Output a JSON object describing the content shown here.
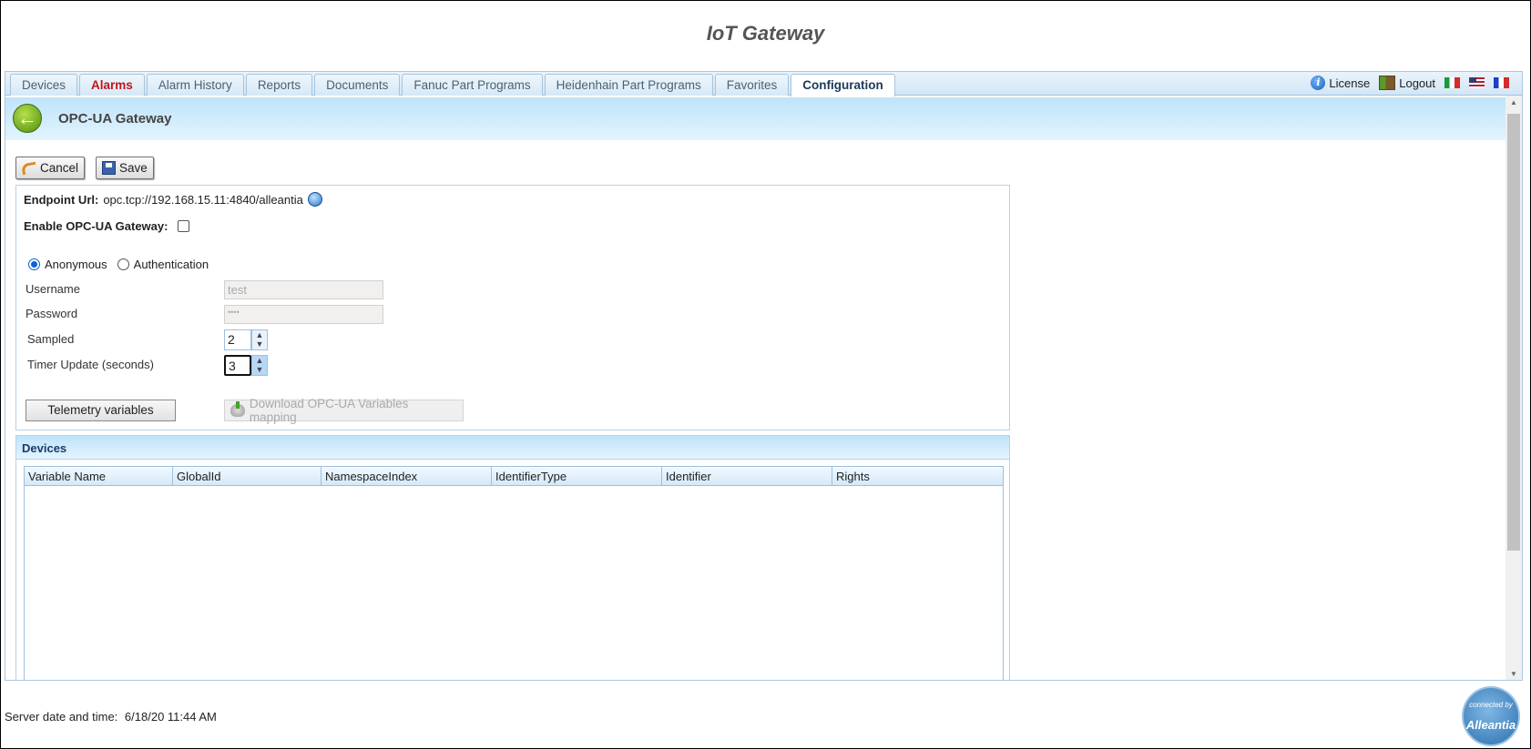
{
  "app": {
    "title": "IoT Gateway"
  },
  "tabs": [
    {
      "label": "Devices"
    },
    {
      "label": "Alarms"
    },
    {
      "label": "Alarm History"
    },
    {
      "label": "Reports"
    },
    {
      "label": "Documents"
    },
    {
      "label": "Fanuc Part Programs"
    },
    {
      "label": "Heidenhain Part Programs"
    },
    {
      "label": "Favorites"
    },
    {
      "label": "Configuration",
      "active": true
    }
  ],
  "topbar": {
    "license": "License",
    "logout": "Logout",
    "flags": [
      "italian-flag-icon",
      "us-flag-icon",
      "french-flag-icon"
    ]
  },
  "header": {
    "title": "OPC-UA Gateway",
    "back_icon": "back-arrow-icon"
  },
  "toolbar": {
    "cancel": "Cancel",
    "save": "Save"
  },
  "form": {
    "endpoint_label": "Endpoint Url:",
    "endpoint_value": "opc.tcp://192.168.15.11:4840/alleantia",
    "enable_label": "Enable OPC-UA Gateway:",
    "enable_checked": false,
    "auth_options": [
      "Anonymous",
      "Authentication"
    ],
    "auth_selected": "Anonymous",
    "username_label": "Username",
    "username_value": "test",
    "password_label": "Password",
    "password_value": "••••",
    "sampled_label": "Sampled",
    "sampled_value": "2",
    "timer_label": "Timer Update (seconds)",
    "timer_value": "3",
    "telemetry_button": "Telemetry variables",
    "download_button": "Download OPC-UA Variables mapping"
  },
  "devices": {
    "title": "Devices",
    "columns": [
      "Variable Name",
      "GlobalId",
      "NamespaceIndex",
      "IdentifierType",
      "Identifier",
      "Rights"
    ],
    "rows": []
  },
  "footer": {
    "label": "Server date and time:",
    "value": "6/18/20 11:44 AM"
  },
  "logo": {
    "line1": "connected by",
    "line2": "Alleantia"
  },
  "colors": {
    "accent": "#1b3a5a",
    "alarm": "#c0141a",
    "header_bg": "#bfe3fa"
  }
}
